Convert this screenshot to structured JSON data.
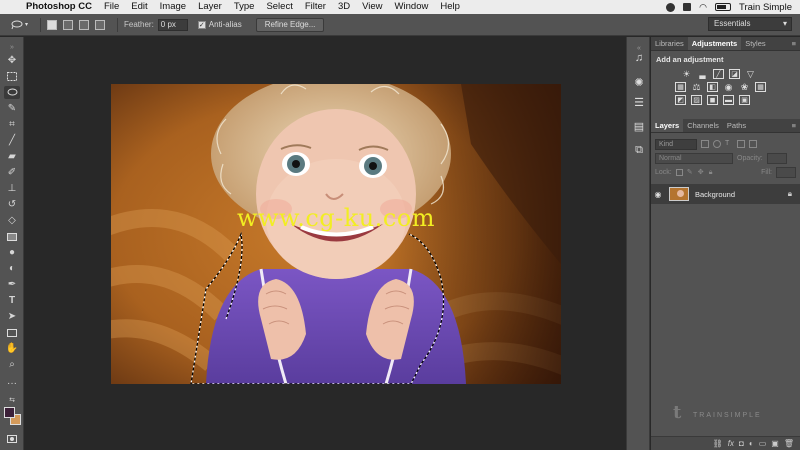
{
  "menubar": {
    "apple_icon": "apple-icon",
    "app_name": "Photoshop CC",
    "items": [
      "File",
      "Edit",
      "Image",
      "Layer",
      "Type",
      "Select",
      "Filter",
      "3D",
      "View",
      "Window",
      "Help"
    ],
    "user": "Train Simple"
  },
  "options": {
    "feather_label": "Feather:",
    "feather_value": "0 px",
    "antialias_label": "Anti-alias",
    "antialias_checked": true,
    "refine_label": "Refine Edge...",
    "workspace": "Essentials"
  },
  "tools": [
    "move-icon",
    "marquee-icon",
    "lasso-icon",
    "quick-select-icon",
    "crop-icon",
    "eyedropper-icon",
    "healing-icon",
    "brush-icon",
    "stamp-icon",
    "history-brush-icon",
    "eraser-icon",
    "gradient-icon",
    "blur-icon",
    "dodge-icon",
    "pen-icon",
    "type-icon",
    "path-select-icon",
    "shape-icon",
    "hand-icon",
    "zoom-icon",
    "more-icon"
  ],
  "colors": {
    "foreground": "#3c2038",
    "background": "#d49a5a",
    "ui_bg": "#535353",
    "canvas_bg": "#282828",
    "watermark": "#f2ee22"
  },
  "canvas": {
    "watermark_text": "www.cg-ku.com"
  },
  "panels": {
    "top_tabs": [
      "Libraries",
      "Adjustments",
      "Styles"
    ],
    "active_top_tab": "Adjustments",
    "adjustments_title": "Add an adjustment",
    "layers_tabs": [
      "Layers",
      "Channels",
      "Paths"
    ],
    "kind_placeholder": "Kind",
    "blend_mode": "Normal",
    "opacity_label": "Opacity:",
    "lock_label": "Lock:",
    "fill_label": "Fill:",
    "layer_name": "Background"
  },
  "branding": {
    "logo_text": "TRAINSIMPLE"
  }
}
